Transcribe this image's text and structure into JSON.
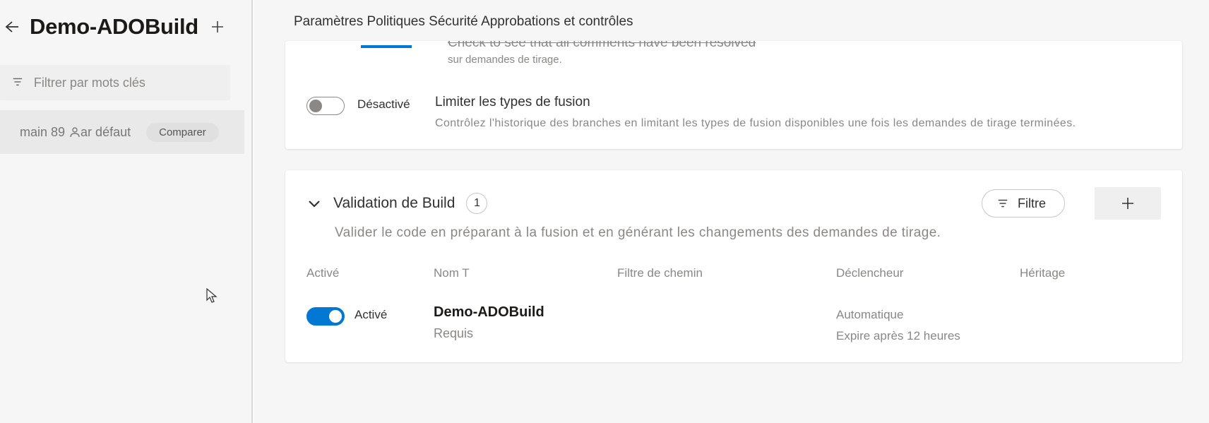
{
  "sidebar": {
    "title": "Demo-ADOBuild",
    "filter_placeholder": "Filtrer par mots clés",
    "branch": "main 89",
    "default_label": "ar défaut",
    "compare_label": "Comparer"
  },
  "breadcrumbs": "Paramètres Politiques Sécurité Approbations et contrôles",
  "policy_cut": {
    "line1": "Check to see that all comments have been resolved",
    "line2": "sur demandes de tirage."
  },
  "merge_policy": {
    "toggle_label": "Désactivé",
    "title": "Limiter les types de fusion",
    "desc": "Contrôlez l'historique des branches en limitant les types de fusion disponibles une fois les demandes de tirage terminées."
  },
  "build_validation": {
    "header": "Validation de Build",
    "count": "1",
    "filter_label": "Filtre",
    "desc": "Valider le code en préparant à la fusion et en générant les changements des demandes de tirage.",
    "columns": {
      "enabled": "Activé",
      "name": "Nom T",
      "path": "Filtre de chemin",
      "trigger": "Déclencheur",
      "inherit": "Héritage"
    },
    "row": {
      "toggle_label": "Activé",
      "name": "Demo-ADOBuild",
      "requirement": "Requis",
      "trigger1": "Automatique",
      "trigger2": "Expire après 12 heures"
    }
  }
}
